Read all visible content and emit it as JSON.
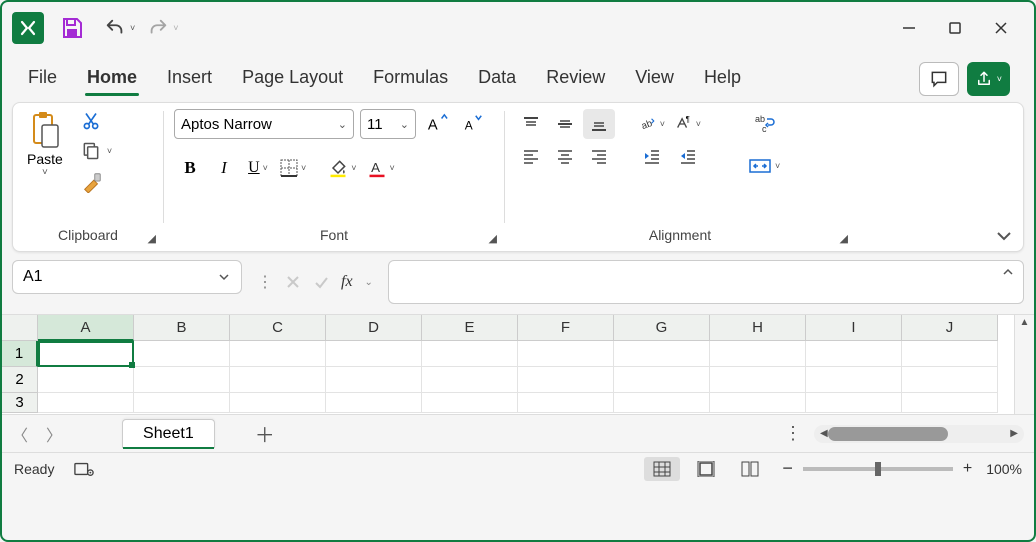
{
  "qat": {
    "undo_caret": "˅",
    "redo_caret": "˅"
  },
  "tabs": [
    "File",
    "Home",
    "Insert",
    "Page Layout",
    "Formulas",
    "Data",
    "Review",
    "View",
    "Help"
  ],
  "active_tab": "Home",
  "ribbon": {
    "clipboard": {
      "label": "Clipboard",
      "paste": "Paste"
    },
    "font": {
      "label": "Font",
      "name": "Aptos Narrow",
      "size": "11"
    },
    "alignment": {
      "label": "Alignment"
    }
  },
  "namebox": "A1",
  "columns": [
    "A",
    "B",
    "C",
    "D",
    "E",
    "F",
    "G",
    "H",
    "I",
    "J"
  ],
  "rows": [
    "1",
    "2",
    "3"
  ],
  "sheet": {
    "active": "Sheet1"
  },
  "status": {
    "ready": "Ready",
    "zoom": "100%"
  }
}
